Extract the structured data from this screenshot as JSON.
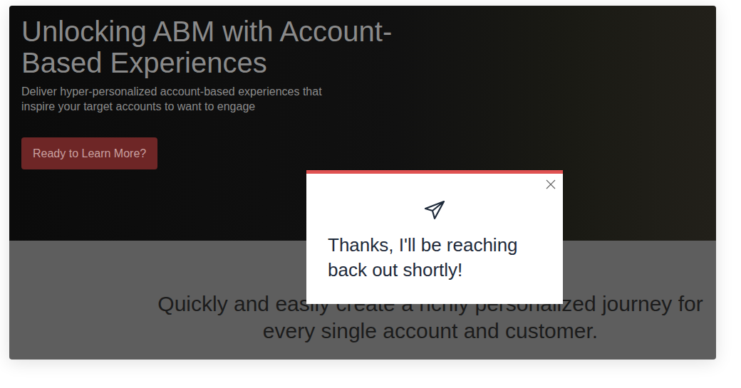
{
  "hero": {
    "title": "Unlocking ABM with Account-Based Experiences",
    "subtitle": "Deliver hyper-personalized account-based experiences that inspire your target accounts to want to engage",
    "button": "Ready to Learn More?"
  },
  "tagline": "Quickly and easily create a richly personalized journey for every single account and customer.",
  "modal": {
    "message": "Thanks, I'll be reaching back out shortly!"
  }
}
